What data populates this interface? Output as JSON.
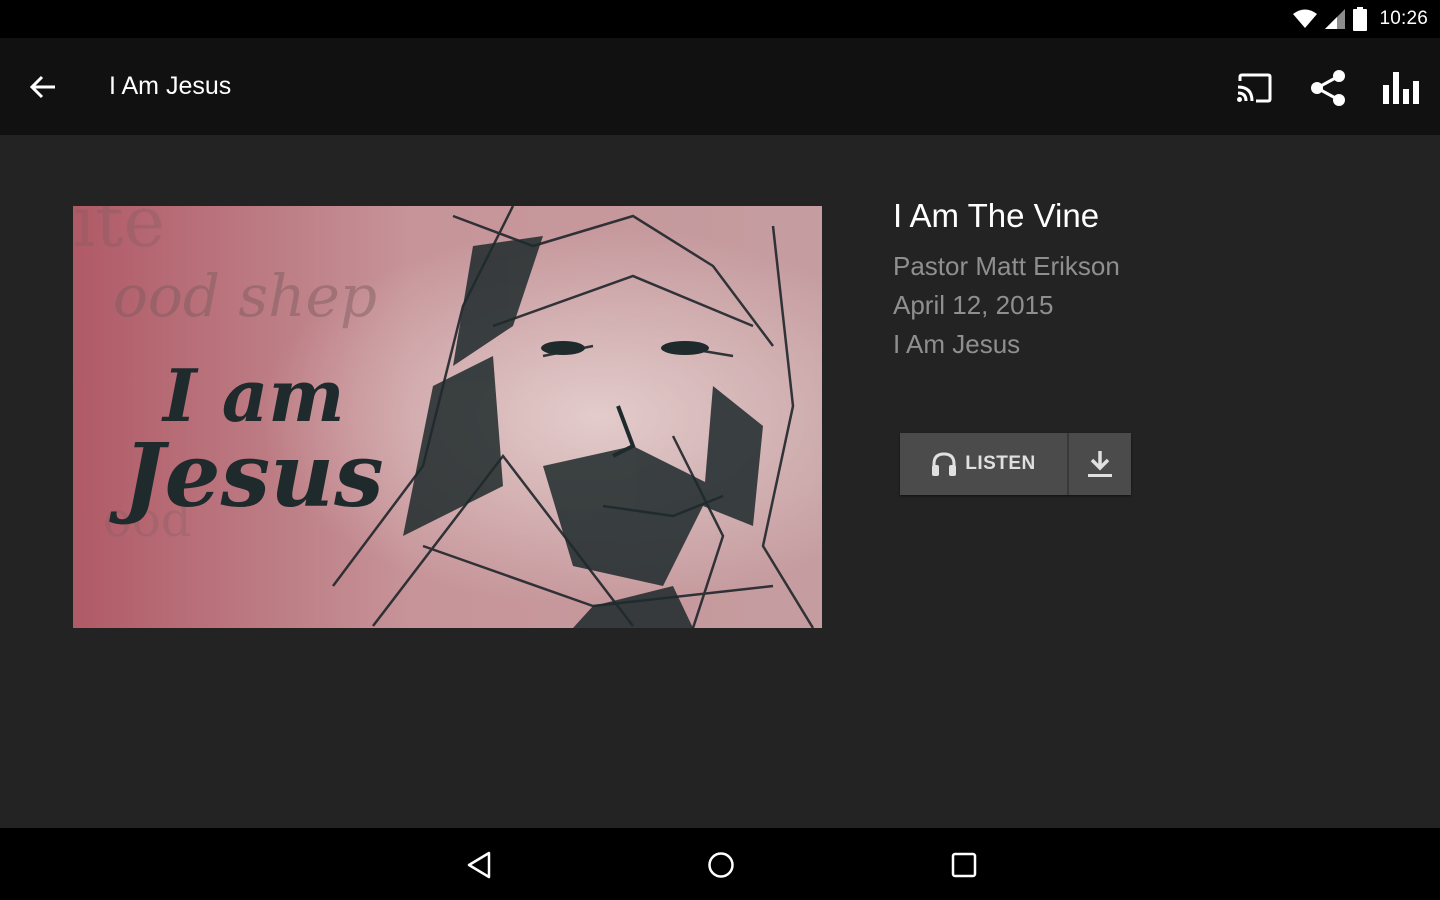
{
  "status_bar": {
    "time": "10:26",
    "icons": [
      "wifi-icon",
      "cell-signal-icon",
      "battery-icon"
    ]
  },
  "toolbar": {
    "title": "I Am Jesus",
    "actions": [
      "cast-icon",
      "share-icon",
      "bar-chart-icon"
    ]
  },
  "sermon": {
    "title": "I Am The Vine",
    "speaker": "Pastor Matt Erikson",
    "date": "April 12, 2015",
    "series": "I Am Jesus",
    "artwork_text": [
      "I am",
      "Jesus",
      "ood shep"
    ]
  },
  "actions": {
    "listen_label": "LISTEN"
  },
  "colors": {
    "background": "#232323",
    "toolbar": "#111111",
    "button": "#4b4b4b",
    "meta_text": "#8f8f8f"
  }
}
